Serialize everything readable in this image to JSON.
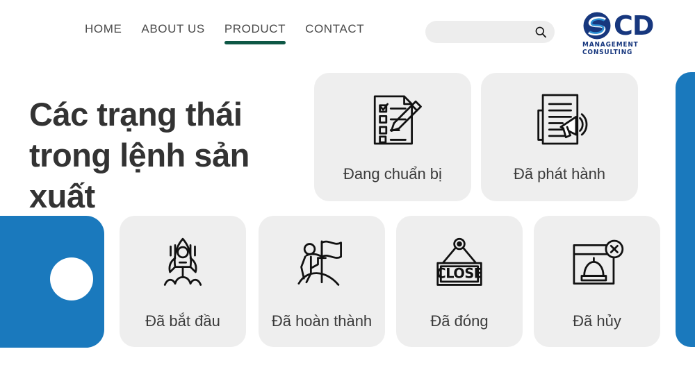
{
  "site": {
    "logo": {
      "mark": "swirl-circle-logo",
      "text": "CD",
      "subtitle": "MANAGEMENT CONSULTING"
    }
  },
  "header": {
    "nav": [
      {
        "label": "HOME",
        "active": false
      },
      {
        "label": "ABOUT US",
        "active": false
      },
      {
        "label": "PRODUCT",
        "active": true
      },
      {
        "label": "CONTACT",
        "active": false
      }
    ],
    "search": {
      "value": "",
      "placeholder": "",
      "icon": "search-icon"
    },
    "active_underline_color": "#0e5745"
  },
  "main": {
    "headline": "Các trạng thái trong lệnh sản xuất",
    "cards": [
      {
        "label": "Đang chuẩn bị",
        "icon": "checklist-pencil-icon"
      },
      {
        "label": "Đã phát hành",
        "icon": "document-megaphone-icon"
      },
      {
        "label": "Đã bắt đầu",
        "icon": "rocket-launch-icon"
      },
      {
        "label": "Đã hoàn thành",
        "icon": "person-flag-summit-icon"
      },
      {
        "label": "Đã đóng",
        "icon": "close-sign-icon",
        "sign_text": "CLOSE"
      },
      {
        "label": "Đã hủy",
        "icon": "window-cancel-icon"
      }
    ]
  },
  "decor": {
    "blue": "#1a79bd",
    "card_bg": "#eeeeee",
    "left_shape": "rounded-square-with-dot",
    "right_shape": "rounded-bar"
  }
}
